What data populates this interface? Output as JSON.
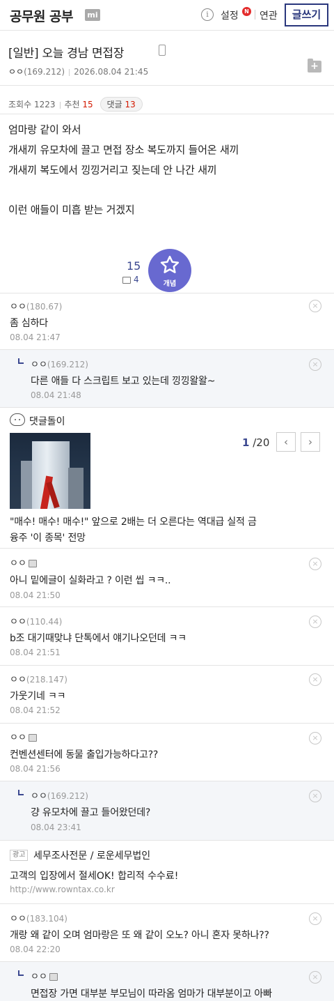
{
  "header": {
    "gallery_title": "공무원 공부",
    "mi_badge": "mi",
    "info_icon": "ⓘ",
    "setting": "설정",
    "new_badge": "N",
    "related": "연관",
    "write_button": "글쓰기"
  },
  "post": {
    "title": "[일반] 오늘 경남 면접장",
    "author": "ㅇㅇ",
    "ip": "(169.212)",
    "datetime": "2026.08.04 21:45",
    "views_label": "조회수",
    "views": "1223",
    "recommend_label": "추천",
    "recommend": "15",
    "comments_label": "댓글",
    "comments": "13",
    "body": [
      "엄마랑 같이 와서",
      "개새끼 유모차에 끌고 면접 장소 복도까지 들어온 새끼",
      "개새끼 복도에서 낑낑거리고 짖는데 안 나간 새끼",
      "",
      "이런 애들이 미흡 받는 거겠지"
    ],
    "recommend_count": "15",
    "image_recommend": "4",
    "recommend_button": "개념"
  },
  "comments": [
    {
      "nick": "ㅇㅇ",
      "ip": "(180.67)",
      "text": "좀 심하다",
      "date": "08.04 21:47"
    },
    {
      "nick": "ㅇㅇ",
      "ip": "(169.212)",
      "text": "다른 애들 다 스크립트 보고 있는데 낑낑왈왈~",
      "date": "08.04 21:48"
    },
    {
      "nick": "ㅇㅇ",
      "ip": "",
      "text": "아니 밑에글이 실화라고 ? 이런 씹 ㅋㅋ..",
      "date": "08.04 21:50"
    },
    {
      "nick": "ㅇㅇ",
      "ip": "(110.44)",
      "text": "b조 대기때맞냐 단톡에서 얘기나오던데 ㅋㅋ",
      "date": "08.04 21:51"
    },
    {
      "nick": "ㅇㅇ",
      "ip": "(218.147)",
      "text": "가웃기네 ㅋㅋ",
      "date": "08.04 21:52"
    },
    {
      "nick": "ㅇㅇ",
      "ip": "",
      "text": "컨벤션센터에 동물 출입가능하다고??",
      "date": "08.04 21:56"
    },
    {
      "nick": "ㅇㅇ",
      "ip": "(169.212)",
      "text": "걍 유모차에 끌고 들어왔던데?",
      "date": "08.04 23:41"
    },
    {
      "nick": "ㅇㅇ",
      "ip": "(183.104)",
      "text": "개랑 왜 같이 오며 엄마랑은 또 왜 같이 오노? 아니 혼자 못하나??",
      "date": "08.04 22:20"
    },
    {
      "nick": "ㅇㅇ",
      "ip": "",
      "text": "면접장 가면 대부분 부모님이 따라옴 엄마가 대부분이고 아빠",
      "date": ""
    }
  ],
  "bot": {
    "title": "댓글돌이",
    "page_current": "1",
    "page_total": "/20",
    "prev": "‹",
    "next": "›",
    "text_line1": "\"매수! 매수! 매수!\" 앞으로 2배는 더 오른다는 역대급 실적 금",
    "text_line2": "융주 '이 종목' 전망"
  },
  "ad": {
    "badge": "광고",
    "title": "세무조사전문 / 로운세무법인",
    "text": "고객의 입장에서 절세OK! 합리적 수수료!",
    "url": "http://www.rowntax.co.kr"
  },
  "colors": {
    "accent": "#29367c",
    "recommend": "#6869d0",
    "highlight": "#d31900"
  }
}
